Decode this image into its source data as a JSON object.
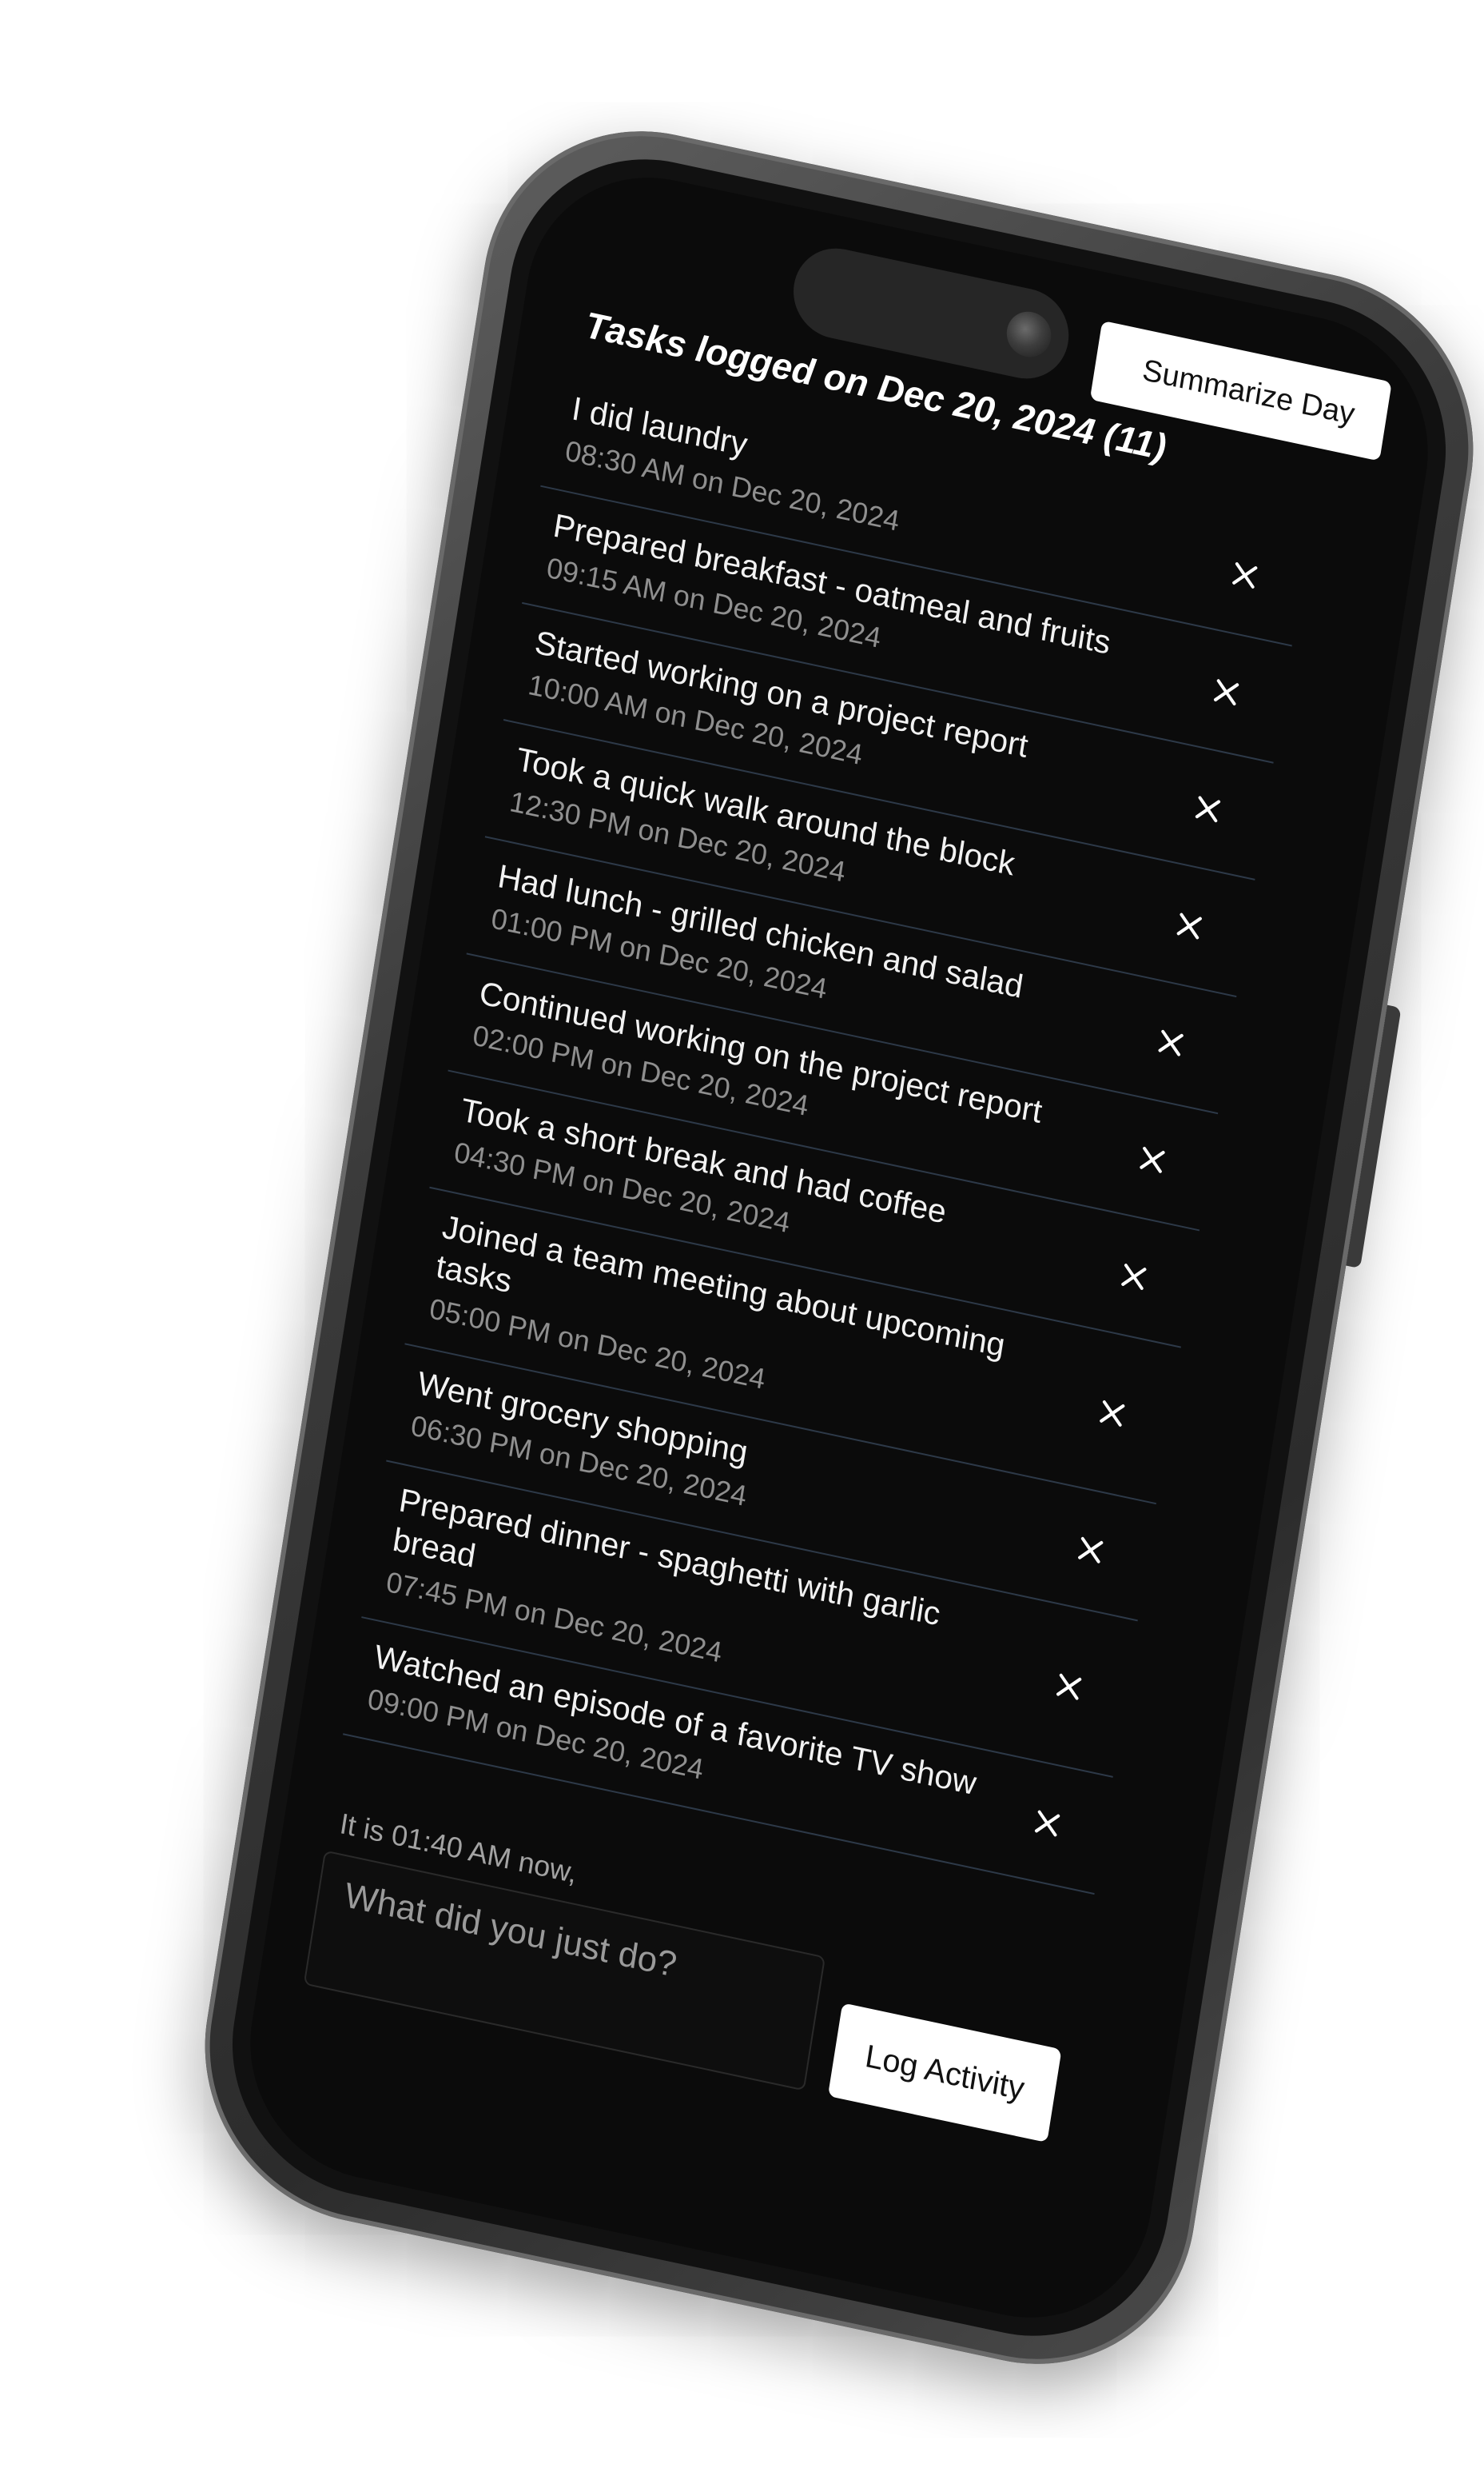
{
  "header": {
    "summarize_label": "Summarize Day",
    "title": "Tasks logged on Dec 20, 2024 (11)"
  },
  "tasks": [
    {
      "text": "I did laundry",
      "time": "08:30 AM on Dec 20, 2024"
    },
    {
      "text": "Prepared breakfast - oatmeal and fruits",
      "time": "09:15 AM on Dec 20, 2024"
    },
    {
      "text": "Started working on a project report",
      "time": "10:00 AM on Dec 20, 2024"
    },
    {
      "text": "Took a quick walk around the block",
      "time": "12:30 PM on Dec 20, 2024"
    },
    {
      "text": "Had lunch - grilled chicken and salad",
      "time": "01:00 PM on Dec 20, 2024"
    },
    {
      "text": "Continued working on the project report",
      "time": "02:00 PM on Dec 20, 2024"
    },
    {
      "text": "Took a short break and had coffee",
      "time": "04:30 PM on Dec 20, 2024"
    },
    {
      "text": "Joined a team meeting about upcoming tasks",
      "time": "05:00 PM on Dec 20, 2024"
    },
    {
      "text": "Went grocery shopping",
      "time": "06:30 PM on Dec 20, 2024"
    },
    {
      "text": "Prepared dinner - spaghetti with garlic bread",
      "time": "07:45 PM on Dec 20, 2024"
    },
    {
      "text": "Watched an episode of a favorite TV show",
      "time": "09:00 PM on Dec 20, 2024"
    }
  ],
  "delete_icon": "close-icon",
  "composer": {
    "now_text": "It is 01:40 AM now,",
    "input_placeholder": "What did you just do?",
    "input_value": "",
    "log_label": "Log Activity"
  },
  "colors": {
    "screen_background": "#0b0b0b",
    "divider": "#2d3948",
    "timestamp": "#8f8f8f",
    "button_background": "#ffffff"
  }
}
